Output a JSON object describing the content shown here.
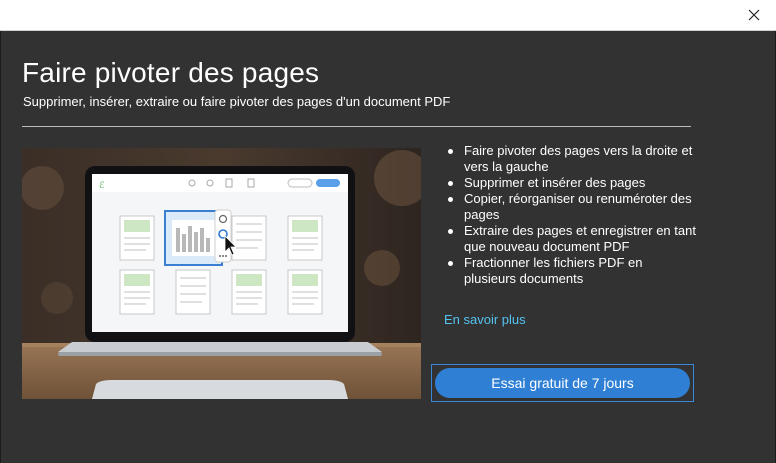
{
  "window": {
    "close_icon": "close-icon"
  },
  "dialog": {
    "title": "Faire pivoter des pages",
    "subtitle": "Supprimer, insérer, extraire ou faire pivoter des pages d'un document PDF",
    "features": [
      "Faire pivoter des pages vers la droite et vers la gauche",
      "Supprimer et insérer des pages",
      "Copier, réorganiser ou renuméroter des pages",
      "Extraire des pages et enregistrer en tant que nouveau document PDF",
      "Fractionner les fichiers PDF en plusieurs documents"
    ],
    "learn_more": "En savoir plus",
    "trial_button": "Essai gratuit de 7 jours"
  },
  "colors": {
    "dialog_bg": "#323232",
    "accent_button": "#2f7fd4",
    "link": "#55c3f0",
    "brand_green": "#4caf50"
  }
}
